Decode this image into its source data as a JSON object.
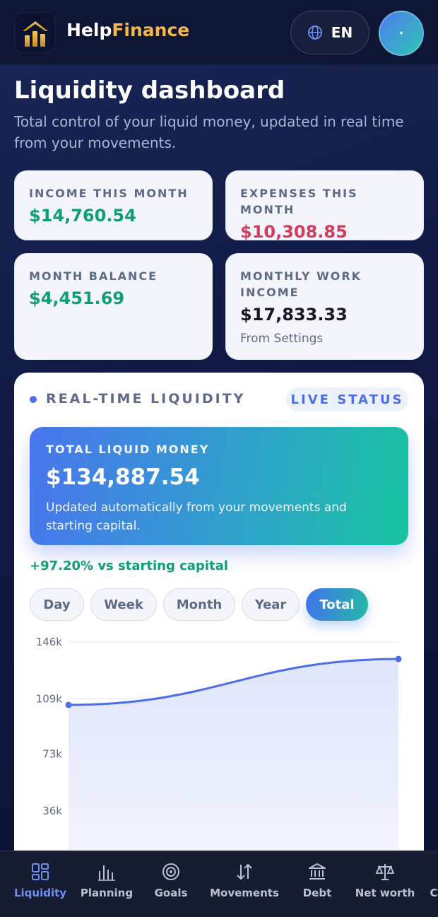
{
  "header": {
    "brand_part1": "Help",
    "brand_part2": "Finance",
    "lang_label": "EN",
    "avatar_text": "·",
    "colors": {
      "brand_accent": "#f2b84b",
      "primary": "#4c6ee8",
      "positive": "#0f9d74",
      "negative": "#d23c5e"
    }
  },
  "page": {
    "title": "Liquidity dashboard",
    "subtitle": "Total control of your liquid money, updated in real time from your movements."
  },
  "stats": [
    {
      "label": "INCOME THIS MONTH",
      "value": "$14,760.54",
      "tone": "green"
    },
    {
      "label": "EXPENSES THIS MONTH",
      "value": "$10,308.85",
      "tone": "red"
    },
    {
      "label": "MONTH BALANCE",
      "value": "$4,451.69",
      "tone": "green"
    },
    {
      "label": "MONTHLY WORK INCOME",
      "value": "$17,833.33",
      "tone": "dark",
      "note": "From Settings"
    }
  ],
  "liquidity": {
    "section_title": "REAL-TIME LIQUIDITY",
    "badge": "LIVE STATUS",
    "card_label": "TOTAL LIQUID MONEY",
    "card_value": "$134,887.54",
    "card_note": "Updated automatically from your movements and starting capital.",
    "change": "+97.20% vs starting capital",
    "ranges": [
      "Day",
      "Week",
      "Month",
      "Year",
      "Total"
    ],
    "active_range": "Total"
  },
  "chart_data": {
    "type": "area",
    "y_ticks": [
      "146k",
      "109k",
      "73k",
      "36k"
    ],
    "ylim": [
      0,
      146000
    ],
    "grid": true,
    "points": [
      {
        "x": 0,
        "y": 105000
      },
      {
        "x": 1,
        "y": 134887.54
      }
    ],
    "line_color": "#4c6ee8"
  },
  "nav": [
    {
      "label": "Liquidity",
      "icon": "grid-icon",
      "active": true
    },
    {
      "label": "Planning",
      "icon": "bars-icon",
      "active": false
    },
    {
      "label": "Goals",
      "icon": "target-icon",
      "active": false
    },
    {
      "label": "Movements",
      "icon": "arrows-updown-icon",
      "active": false
    },
    {
      "label": "Debt",
      "icon": "bank-icon",
      "active": false
    },
    {
      "label": "Net worth",
      "icon": "scale-icon",
      "active": false
    },
    {
      "label": "C",
      "icon": "",
      "active": false
    }
  ]
}
